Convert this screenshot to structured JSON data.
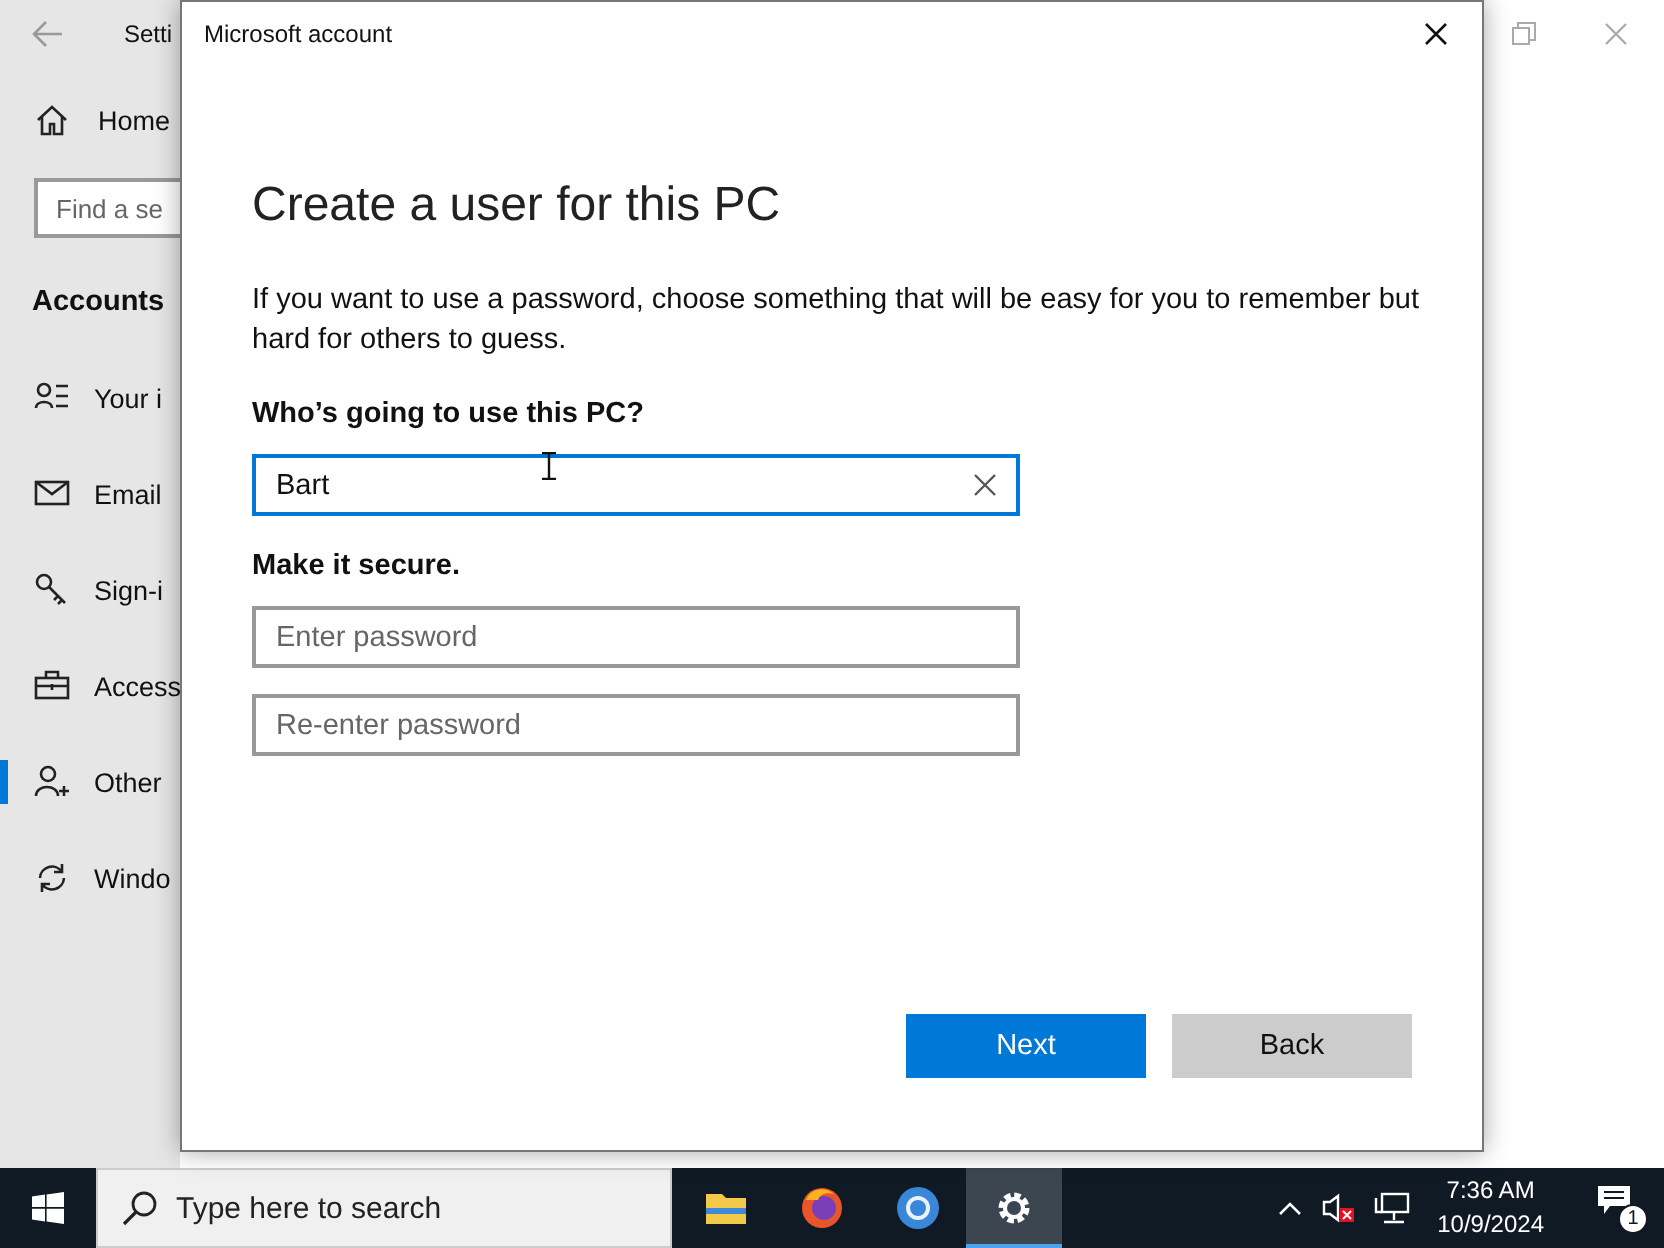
{
  "settings_window": {
    "title": "Setti",
    "home": "Home",
    "search": {
      "placeholder": "Find a se"
    },
    "section": "Accounts",
    "items": [
      {
        "label": "Your i",
        "kind": "person-list",
        "selected": false
      },
      {
        "label": "Email",
        "kind": "mail",
        "selected": false
      },
      {
        "label": "Sign-i",
        "kind": "key",
        "selected": false
      },
      {
        "label": "Access",
        "kind": "briefcase",
        "selected": false
      },
      {
        "label": "Other",
        "kind": "person-add",
        "selected": true
      },
      {
        "label": "Windo",
        "kind": "sync",
        "selected": false
      }
    ]
  },
  "dialog": {
    "title": "Microsoft account",
    "heading": "Create a user for this PC",
    "description": "If you want to use a password, choose something that will be easy for you to remember but hard for others to guess.",
    "name_label": "Who’s going to use this PC?",
    "name_field": {
      "value": "Bart"
    },
    "secure_label": "Make it secure.",
    "password_fields": [
      {
        "placeholder": "Enter password"
      },
      {
        "placeholder": "Re-enter password"
      }
    ],
    "buttons": [
      {
        "label": "Next",
        "kind": "primary"
      },
      {
        "label": "Back",
        "kind": "secondary"
      }
    ]
  },
  "taskbar": {
    "search": {
      "placeholder": "Type here to search"
    },
    "apps": [
      {
        "kind": "files",
        "selected": false
      },
      {
        "kind": "firefox",
        "selected": false
      },
      {
        "kind": "browser",
        "selected": false
      },
      {
        "kind": "settings",
        "selected": true
      }
    ],
    "time": "7:36 AM",
    "date": "10/9/2024",
    "notification_count": "1"
  }
}
